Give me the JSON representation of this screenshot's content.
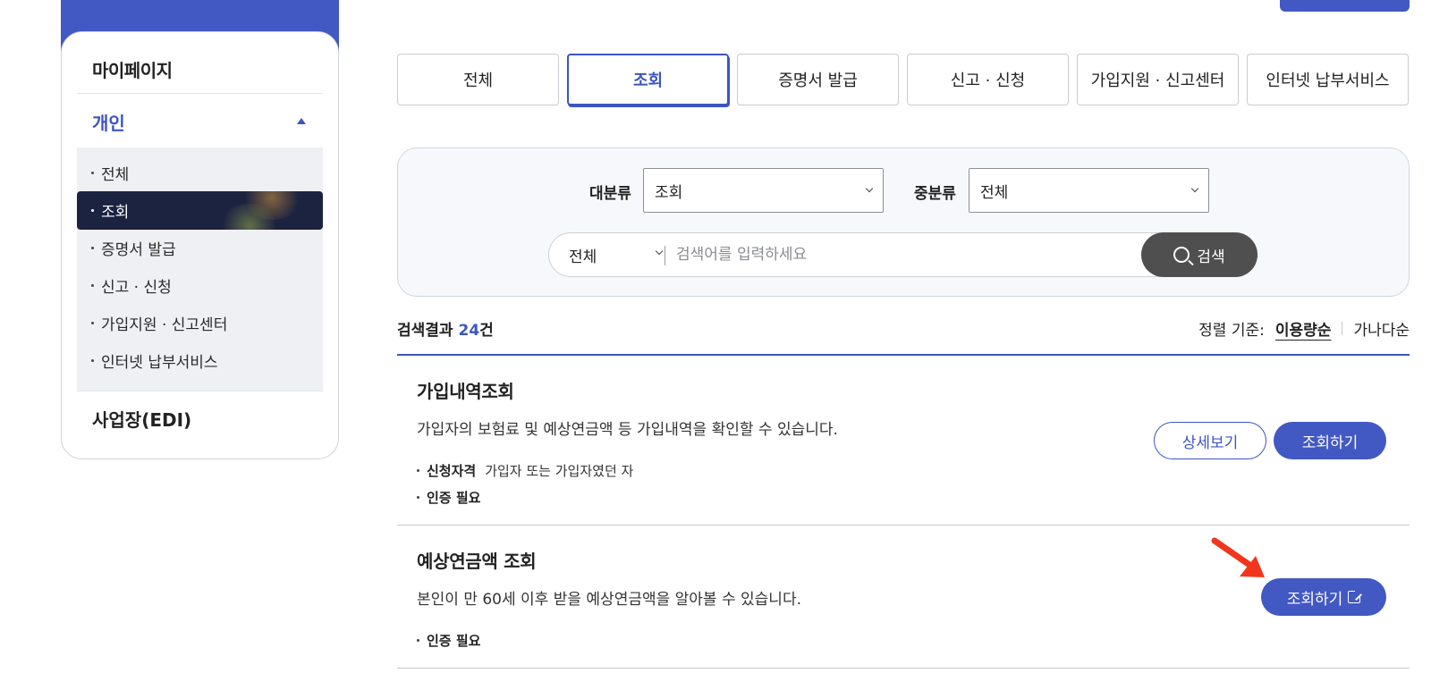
{
  "sidebar": {
    "title": "마이페이지",
    "group": "개인",
    "items": [
      {
        "label": "전체"
      },
      {
        "label": "조회"
      },
      {
        "label": "증명서 발급"
      },
      {
        "label": "신고 · 신청"
      },
      {
        "label": "가입지원 · 신고센터"
      },
      {
        "label": "인터넷 납부서비스"
      }
    ],
    "active_index": 1,
    "business": "사업장(EDI)"
  },
  "tabs": [
    {
      "label": "전체"
    },
    {
      "label": "조회"
    },
    {
      "label": "증명서 발급"
    },
    {
      "label": "신고 · 신청"
    },
    {
      "label": "가입지원 · 신고센터"
    },
    {
      "label": "인터넷 납부서비스"
    }
  ],
  "active_tab": "조회",
  "filters": {
    "major_label": "대분류",
    "major_value": "조회",
    "minor_label": "중분류",
    "minor_value": "전체"
  },
  "search": {
    "scope": "전체",
    "placeholder": "검색어를 입력하세요",
    "button": "검색"
  },
  "results": {
    "prefix": "검색결과 ",
    "count": "24",
    "suffix": "건",
    "sort_label": "정렬 기준:",
    "sort_options": [
      "이용량순",
      "가나다순"
    ],
    "sort_selected": "이용량순"
  },
  "items": [
    {
      "title": "가입내역조회",
      "description": "가입자의 보험료 및 예상연금액 등 가입내역을 확인할 수 있습니다.",
      "eligibility_label": "신청자격",
      "eligibility_value": "가입자 또는 가입자였던 자",
      "auth": "인증 필요",
      "detail_button": "상세보기",
      "action_button": "조회하기"
    },
    {
      "title": "예상연금액 조회",
      "description": "본인이 만 60세 이후 받을 예상연금액을 알아볼 수 있습니다.",
      "auth": "인증 필요",
      "action_button": "조회하기"
    }
  ],
  "colors": {
    "accent": "#3d55c1",
    "sidebar_active": "#1c2341",
    "search_button": "#4f4f4f",
    "annotation_arrow": "#f2361d"
  }
}
